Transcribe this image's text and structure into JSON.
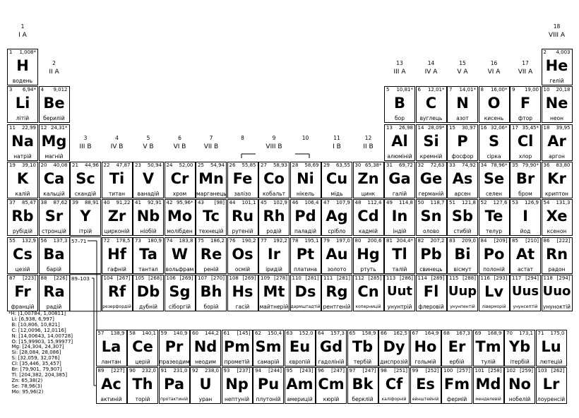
{
  "groups": [
    {
      "n": "1",
      "label": "I A"
    },
    {
      "n": "2",
      "label": "II A"
    },
    {
      "n": "3",
      "label": "III B"
    },
    {
      "n": "4",
      "label": "IV B"
    },
    {
      "n": "5",
      "label": "V B"
    },
    {
      "n": "6",
      "label": "VI B"
    },
    {
      "n": "7",
      "label": "VII B"
    },
    {
      "n": "8",
      "label": ""
    },
    {
      "n": "9",
      "label": "VIII B"
    },
    {
      "n": "10",
      "label": ""
    },
    {
      "n": "11",
      "label": "I B"
    },
    {
      "n": "12",
      "label": "II B"
    },
    {
      "n": "13",
      "label": "III A"
    },
    {
      "n": "14",
      "label": "IV A"
    },
    {
      "n": "15",
      "label": "V A"
    },
    {
      "n": "16",
      "label": "VI A"
    },
    {
      "n": "17",
      "label": "VII A"
    },
    {
      "n": "18",
      "label": "VIII A"
    }
  ],
  "lanthanide_ref": "57–71",
  "actinide_ref": "89–103",
  "elements": [
    {
      "z": "1",
      "m": "1,008*",
      "s": "H",
      "n": "водень",
      "g": 1,
      "p": 1
    },
    {
      "z": "2",
      "m": "4,003",
      "s": "He",
      "n": "гелій",
      "g": 18,
      "p": 1
    },
    {
      "z": "3",
      "m": "6,94*",
      "s": "Li",
      "n": "літій",
      "g": 1,
      "p": 2
    },
    {
      "z": "4",
      "m": "9,012",
      "s": "Be",
      "n": "берилій",
      "g": 2,
      "p": 2
    },
    {
      "z": "5",
      "m": "10,81*",
      "s": "B",
      "n": "бор",
      "g": 13,
      "p": 2
    },
    {
      "z": "6",
      "m": "12,01*",
      "s": "C",
      "n": "вуглець",
      "g": 14,
      "p": 2
    },
    {
      "z": "7",
      "m": "14,01*",
      "s": "N",
      "n": "азот",
      "g": 15,
      "p": 2
    },
    {
      "z": "8",
      "m": "16,00*",
      "s": "O",
      "n": "кисень",
      "g": 16,
      "p": 2
    },
    {
      "z": "9",
      "m": "19,00",
      "s": "F",
      "n": "фтор",
      "g": 17,
      "p": 2
    },
    {
      "z": "10",
      "m": "20,18",
      "s": "Ne",
      "n": "неон",
      "g": 18,
      "p": 2
    },
    {
      "z": "11",
      "m": "22,99",
      "s": "Na",
      "n": "натрій",
      "g": 1,
      "p": 3
    },
    {
      "z": "12",
      "m": "24,31*",
      "s": "Mg",
      "n": "магній",
      "g": 2,
      "p": 3
    },
    {
      "z": "13",
      "m": "26,98",
      "s": "Al",
      "n": "алюміній",
      "g": 13,
      "p": 3
    },
    {
      "z": "14",
      "m": "28,09*",
      "s": "Si",
      "n": "кремній",
      "g": 14,
      "p": 3
    },
    {
      "z": "15",
      "m": "30,97",
      "s": "P",
      "n": "фосфор",
      "g": 15,
      "p": 3
    },
    {
      "z": "16",
      "m": "32,06*",
      "s": "S",
      "n": "сірка",
      "g": 16,
      "p": 3
    },
    {
      "z": "17",
      "m": "35,45*",
      "s": "Cl",
      "n": "хлор",
      "g": 17,
      "p": 3
    },
    {
      "z": "18",
      "m": "39,95",
      "s": "Ar",
      "n": "аргон",
      "g": 18,
      "p": 3
    },
    {
      "z": "19",
      "m": "39,10",
      "s": "K",
      "n": "калій",
      "g": 1,
      "p": 4
    },
    {
      "z": "20",
      "m": "40,08",
      "s": "Ca",
      "n": "кальцій",
      "g": 2,
      "p": 4
    },
    {
      "z": "21",
      "m": "44,96",
      "s": "Sc",
      "n": "скандій",
      "g": 3,
      "p": 4
    },
    {
      "z": "22",
      "m": "47,87",
      "s": "Ti",
      "n": "титан",
      "g": 4,
      "p": 4
    },
    {
      "z": "23",
      "m": "50,94",
      "s": "V",
      "n": "ванадій",
      "g": 5,
      "p": 4
    },
    {
      "z": "24",
      "m": "52,00",
      "s": "Cr",
      "n": "хром",
      "g": 6,
      "p": 4
    },
    {
      "z": "25",
      "m": "54,94",
      "s": "Mn",
      "n": "марганець",
      "g": 7,
      "p": 4
    },
    {
      "z": "26",
      "m": "55,85",
      "s": "Fe",
      "n": "залізо",
      "g": 8,
      "p": 4
    },
    {
      "z": "27",
      "m": "58,93",
      "s": "Co",
      "n": "кобальт",
      "g": 9,
      "p": 4
    },
    {
      "z": "28",
      "m": "58,69",
      "s": "Ni",
      "n": "нікель",
      "g": 10,
      "p": 4
    },
    {
      "z": "29",
      "m": "63,55",
      "s": "Cu",
      "n": "мідь",
      "g": 11,
      "p": 4
    },
    {
      "z": "30",
      "m": "65,38*",
      "s": "Zn",
      "n": "цинк",
      "g": 12,
      "p": 4
    },
    {
      "z": "31",
      "m": "69,72",
      "s": "Ga",
      "n": "галій",
      "g": 13,
      "p": 4
    },
    {
      "z": "32",
      "m": "72,63",
      "s": "Ge",
      "n": "германій",
      "g": 14,
      "p": 4
    },
    {
      "z": "33",
      "m": "74,92",
      "s": "As",
      "n": "арсен",
      "g": 15,
      "p": 4
    },
    {
      "z": "34",
      "m": "78,96*",
      "s": "Se",
      "n": "селен",
      "g": 16,
      "p": 4
    },
    {
      "z": "35",
      "m": "79,90*",
      "s": "Br",
      "n": "бром",
      "g": 17,
      "p": 4
    },
    {
      "z": "36",
      "m": "83,80",
      "s": "Kr",
      "n": "криптон",
      "g": 18,
      "p": 4
    },
    {
      "z": "37",
      "m": "85,47",
      "s": "Rb",
      "n": "рубідій",
      "g": 1,
      "p": 5
    },
    {
      "z": "38",
      "m": "87,62",
      "s": "Sr",
      "n": "стронцій",
      "g": 2,
      "p": 5
    },
    {
      "z": "39",
      "m": "88,91",
      "s": "Y",
      "n": "ітрій",
      "g": 3,
      "p": 5
    },
    {
      "z": "40",
      "m": "91,22",
      "s": "Zr",
      "n": "цирконій",
      "g": 4,
      "p": 5
    },
    {
      "z": "41",
      "m": "92,91",
      "s": "Nb",
      "n": "ніобій",
      "g": 5,
      "p": 5
    },
    {
      "z": "42",
      "m": "95,96*",
      "s": "Mo",
      "n": "молібден",
      "g": 6,
      "p": 5
    },
    {
      "z": "43",
      "m": "[98]",
      "s": "Tc",
      "n": "технецій",
      "g": 7,
      "p": 5
    },
    {
      "z": "44",
      "m": "101,1",
      "s": "Ru",
      "n": "рутеній",
      "g": 8,
      "p": 5
    },
    {
      "z": "45",
      "m": "102,9",
      "s": "Rh",
      "n": "родій",
      "g": 9,
      "p": 5
    },
    {
      "z": "46",
      "m": "106,4",
      "s": "Pd",
      "n": "паладій",
      "g": 10,
      "p": 5
    },
    {
      "z": "47",
      "m": "107,9",
      "s": "Ag",
      "n": "срібло",
      "g": 11,
      "p": 5
    },
    {
      "z": "48",
      "m": "112,4",
      "s": "Cd",
      "n": "кадмій",
      "g": 12,
      "p": 5
    },
    {
      "z": "49",
      "m": "114,8",
      "s": "In",
      "n": "індій",
      "g": 13,
      "p": 5
    },
    {
      "z": "50",
      "m": "118,7",
      "s": "Sn",
      "n": "олово",
      "g": 14,
      "p": 5
    },
    {
      "z": "51",
      "m": "121,8",
      "s": "Sb",
      "n": "стибій",
      "g": 15,
      "p": 5
    },
    {
      "z": "52",
      "m": "127,6",
      "s": "Te",
      "n": "телур",
      "g": 16,
      "p": 5
    },
    {
      "z": "53",
      "m": "126,9",
      "s": "I",
      "n": "йод",
      "g": 17,
      "p": 5
    },
    {
      "z": "54",
      "m": "131,3",
      "s": "Xe",
      "n": "ксенон",
      "g": 18,
      "p": 5
    },
    {
      "z": "55",
      "m": "132,9",
      "s": "Cs",
      "n": "цезій",
      "g": 1,
      "p": 6
    },
    {
      "z": "56",
      "m": "137,3",
      "s": "Ba",
      "n": "барій",
      "g": 2,
      "p": 6
    },
    {
      "z": "72",
      "m": "178,5",
      "s": "Hf",
      "n": "гафній",
      "g": 4,
      "p": 6
    },
    {
      "z": "73",
      "m": "180,9",
      "s": "Ta",
      "n": "тантал",
      "g": 5,
      "p": 6
    },
    {
      "z": "74",
      "m": "183,8",
      "s": "W",
      "n": "вольфрам",
      "g": 6,
      "p": 6
    },
    {
      "z": "75",
      "m": "186,2",
      "s": "Re",
      "n": "реній",
      "g": 7,
      "p": 6
    },
    {
      "z": "76",
      "m": "190,2",
      "s": "Os",
      "n": "осмій",
      "g": 8,
      "p": 6
    },
    {
      "z": "77",
      "m": "192,2",
      "s": "Ir",
      "n": "іридій",
      "g": 9,
      "p": 6
    },
    {
      "z": "78",
      "m": "195,1",
      "s": "Pt",
      "n": "платина",
      "g": 10,
      "p": 6
    },
    {
      "z": "79",
      "m": "197,0",
      "s": "Au",
      "n": "золото",
      "g": 11,
      "p": 6
    },
    {
      "z": "80",
      "m": "200,6",
      "s": "Hg",
      "n": "ртуть",
      "g": 12,
      "p": 6
    },
    {
      "z": "81",
      "m": "204,4*",
      "s": "Tl",
      "n": "талій",
      "g": 13,
      "p": 6
    },
    {
      "z": "82",
      "m": "207,2",
      "s": "Pb",
      "n": "свинець",
      "g": 14,
      "p": 6
    },
    {
      "z": "83",
      "m": "209,0",
      "s": "Bi",
      "n": "вісмут",
      "g": 15,
      "p": 6
    },
    {
      "z": "84",
      "m": "[209]",
      "s": "Po",
      "n": "полоній",
      "g": 16,
      "p": 6
    },
    {
      "z": "85",
      "m": "[210]",
      "s": "At",
      "n": "астат",
      "g": 17,
      "p": 6
    },
    {
      "z": "86",
      "m": "[222]",
      "s": "Rn",
      "n": "радон",
      "g": 18,
      "p": 6
    },
    {
      "z": "87",
      "m": "[223]",
      "s": "Fr",
      "n": "францій",
      "g": 1,
      "p": 7
    },
    {
      "z": "88",
      "m": "[226]",
      "s": "Ra",
      "n": "радій",
      "g": 2,
      "p": 7
    },
    {
      "z": "104",
      "m": "[267]",
      "s": "Rf",
      "n": "резерфордій",
      "g": 4,
      "p": 7
    },
    {
      "z": "105",
      "m": "[268]",
      "s": "Db",
      "n": "дубній",
      "g": 5,
      "p": 7
    },
    {
      "z": "106",
      "m": "[269]",
      "s": "Sg",
      "n": "сіборгій",
      "g": 6,
      "p": 7
    },
    {
      "z": "107",
      "m": "[270]",
      "s": "Bh",
      "n": "борій",
      "g": 7,
      "p": 7
    },
    {
      "z": "108",
      "m": "[269]",
      "s": "Hs",
      "n": "гасій",
      "g": 8,
      "p": 7
    },
    {
      "z": "109",
      "m": "[278]",
      "s": "Mt",
      "n": "майтнерій",
      "g": 9,
      "p": 7
    },
    {
      "z": "110",
      "m": "[281]",
      "s": "Ds",
      "n": "дармштадтій",
      "g": 10,
      "p": 7
    },
    {
      "z": "111",
      "m": "[281]",
      "s": "Rg",
      "n": "рентгеній",
      "g": 11,
      "p": 7
    },
    {
      "z": "112",
      "m": "[285]",
      "s": "Cn",
      "n": "коперницій",
      "g": 12,
      "p": 7
    },
    {
      "z": "113",
      "m": "[286]",
      "s": "Uut",
      "n": "унунтрій",
      "g": 13,
      "p": 7
    },
    {
      "z": "114",
      "m": "[289]",
      "s": "Fl",
      "n": "флеровій",
      "g": 14,
      "p": 7
    },
    {
      "z": "115",
      "m": "[288]",
      "s": "Uup",
      "n": "унунпентій",
      "g": 15,
      "p": 7
    },
    {
      "z": "116",
      "m": "[293]",
      "s": "Lv",
      "n": "ліверморій",
      "g": 16,
      "p": 7
    },
    {
      "z": "117",
      "m": "[294]",
      "s": "Uus",
      "n": "унунсептій",
      "g": 17,
      "p": 7
    },
    {
      "z": "118",
      "m": "[294]",
      "s": "Uuo",
      "n": "унуноктій",
      "g": 18,
      "p": 7
    }
  ],
  "lanthanides": [
    {
      "z": "57",
      "m": "138,9",
      "s": "La",
      "n": "лантан"
    },
    {
      "z": "58",
      "m": "140,1",
      "s": "Ce",
      "n": "церій"
    },
    {
      "z": "59",
      "m": "140,9",
      "s": "Pr",
      "n": "празеодим"
    },
    {
      "z": "60",
      "m": "144,2",
      "s": "Nd",
      "n": "неодим"
    },
    {
      "z": "61",
      "m": "[145]",
      "s": "Pm",
      "n": "прометій"
    },
    {
      "z": "62",
      "m": "150,4",
      "s": "Sm",
      "n": "самарій"
    },
    {
      "z": "63",
      "m": "152,0",
      "s": "Eu",
      "n": "європій"
    },
    {
      "z": "64",
      "m": "157,3",
      "s": "Gd",
      "n": "гадоліній"
    },
    {
      "z": "65",
      "m": "158,9",
      "s": "Tb",
      "n": "тербій"
    },
    {
      "z": "66",
      "m": "162,5",
      "s": "Dy",
      "n": "диспрозій"
    },
    {
      "z": "67",
      "m": "164,9",
      "s": "Ho",
      "n": "гольмій"
    },
    {
      "z": "68",
      "m": "167,3",
      "s": "Er",
      "n": "ербій"
    },
    {
      "z": "69",
      "m": "168,9",
      "s": "Tm",
      "n": "тулій"
    },
    {
      "z": "70",
      "m": "173,1",
      "s": "Yb",
      "n": "ітербій"
    },
    {
      "z": "71",
      "m": "175,0",
      "s": "Lu",
      "n": "лютецій"
    }
  ],
  "actinides": [
    {
      "z": "89",
      "m": "[227]",
      "s": "Ac",
      "n": "актиній"
    },
    {
      "z": "90",
      "m": "232,0",
      "s": "Th",
      "n": "торій"
    },
    {
      "z": "91",
      "m": "231,0",
      "s": "Pa",
      "n": "протактиній"
    },
    {
      "z": "92",
      "m": "238,0",
      "s": "U",
      "n": "уран"
    },
    {
      "z": "93",
      "m": "[237]",
      "s": "Np",
      "n": "нептуній"
    },
    {
      "z": "94",
      "m": "[244]",
      "s": "Pu",
      "n": "плутоній"
    },
    {
      "z": "95",
      "m": "[243]",
      "s": "Am",
      "n": "америцій"
    },
    {
      "z": "96",
      "m": "[247]",
      "s": "Cm",
      "n": "кюрій"
    },
    {
      "z": "97",
      "m": "[247]",
      "s": "Bk",
      "n": "берклій"
    },
    {
      "z": "98",
      "m": "[251]",
      "s": "Cf",
      "n": "каліфорній"
    },
    {
      "z": "99",
      "m": "[252]",
      "s": "Es",
      "n": "ейнштейній"
    },
    {
      "z": "100",
      "m": "[257]",
      "s": "Fm",
      "n": "фермій"
    },
    {
      "z": "101",
      "m": "[258]",
      "s": "Md",
      "n": "менделевій"
    },
    {
      "z": "102",
      "m": "[259]",
      "s": "No",
      "n": "нобелій"
    },
    {
      "z": "103",
      "m": "[262]",
      "s": "Lr",
      "n": "лоуренсій"
    }
  ],
  "notes": "*H: [1,00784, 1,00811]\n  Li: [6,938, 6,997]\n  B: [10,806, 10,821]\n  C: [12,0096, 12,0116]\n  N: [14,00643, 14,00728]\n  O: [15,99903, 15,99977]\n  Mg: [24,304, 24,307]\n  Si: [28,084, 28,086]\n  S: [32,059, 32,076]\n  Cl: [35,446, 35,457]\n  Br: [79,901, 79,907]\n  Tl: [204,382, 204,385]\n  Zn: 65,38(2)\n  Se: 78,96(3)\n  Mo: 95,96(2)"
}
